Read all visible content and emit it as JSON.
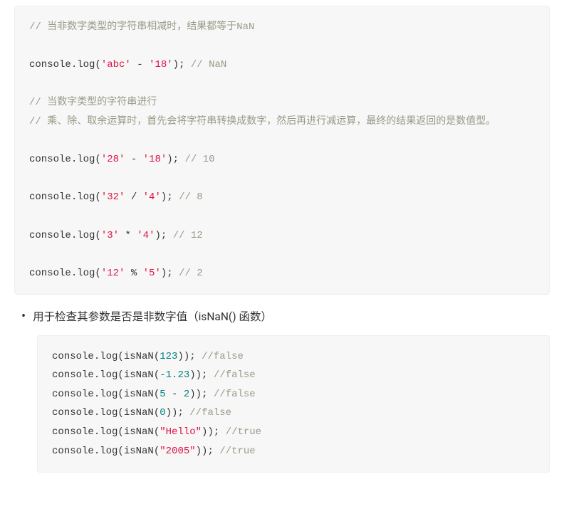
{
  "block1": {
    "line1_comment": "// 当非数字类型的字符串相减时，结果都等于NaN",
    "l3_pre": "console",
    "l3_m": ".log(",
    "l3_s1": "'abc'",
    "l3_op": " - ",
    "l3_s2": "'18'",
    "l3_close": ");",
    "l3_c": " // NaN",
    "l5_comment": "// 当数字类型的字符串进行",
    "l6_comment": "// 乘、除、取余运算时，首先会将字符串转换成数字，然后再进行减运算，最终的结果返回的是数值型。",
    "l8_pre": "console",
    "l8_m": ".log(",
    "l8_s1": "'28'",
    "l8_op": " - ",
    "l8_s2": "'18'",
    "l8_close": ");",
    "l8_c": " // 10",
    "l10_pre": "console",
    "l10_m": ".log(",
    "l10_s1": "'32'",
    "l10_op": " / ",
    "l10_s2": "'4'",
    "l10_close": ");",
    "l10_c": " // 8",
    "l12_pre": "console",
    "l12_m": ".log(",
    "l12_s1": "'3'",
    "l12_op": " * ",
    "l12_s2": "'4'",
    "l12_close": ");",
    "l12_c": " // 12",
    "l14_pre": "console",
    "l14_m": ".log(",
    "l14_s1": "'12'",
    "l14_op": " % ",
    "l14_s2": "'5'",
    "l14_close": ");",
    "l14_c": " // 2"
  },
  "bullet_text": "用于检查其参数是否是非数字值（isNaN() 函数）",
  "block2": {
    "l1_pre": "console",
    "l1_m": ".log(isNaN(",
    "l1_n": "123",
    "l1_close": "));",
    "l1_c": " //false",
    "l2_pre": "console",
    "l2_m": ".log(isNaN(",
    "l2_n": "-1.23",
    "l2_close": "));",
    "l2_c": " //false",
    "l3_pre": "console",
    "l3_m": ".log(isNaN(",
    "l3_n1": "5",
    "l3_op": " - ",
    "l3_n2": "2",
    "l3_close": "));",
    "l3_c": " //false",
    "l4_pre": "console",
    "l4_m": ".log(isNaN(",
    "l4_n": "0",
    "l4_close": "));",
    "l4_c": " //false",
    "l5_pre": "console",
    "l5_m": ".log(isNaN(",
    "l5_s": "\"Hello\"",
    "l5_close": "));",
    "l5_c": " //true",
    "l6_pre": "console",
    "l6_m": ".log(isNaN(",
    "l6_s": "\"2005\"",
    "l6_close": "));",
    "l6_c": " //true"
  }
}
